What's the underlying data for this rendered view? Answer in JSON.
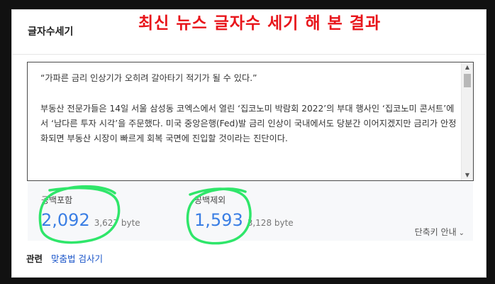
{
  "card": {
    "title": "글자수세기"
  },
  "overlay": {
    "caption": "최신 뉴스 글자수 세기 해 본 결과",
    "caption_color": "#e8151b",
    "highlight_color": "#2fe66a"
  },
  "textarea": {
    "quote": "“가파른 금리 인상기가 오히려 갈아타기 적기가 될 수 있다.”",
    "body": "부동산 전문가들은 14일 서울 삼성동 코엑스에서 열린 ‘집코노미 박람회 2022’의 부대 행사인 ‘집코노미 콘서트’에서 ‘남다른 투자 시각’을 주문했다. 미국 중앙은행(Fed)발 금리 인상이 국내에서도 당분간 이어지겠지만 금리가 안정화되면 부동산 시장이 빠르게 회복 국면에 진입할 것이라는 진단이다."
  },
  "stats": {
    "with_spaces": {
      "label": "공백포함",
      "count": "2,092",
      "bytes": "3,627 byte"
    },
    "without_spaces": {
      "label": "공백제외",
      "count": "1,593",
      "bytes": "3,128 byte"
    },
    "shortcut_label": "단축키 안내",
    "value_color": "#3a7ee4"
  },
  "related": {
    "label": "관련",
    "link": "맞춤법 검사기"
  }
}
